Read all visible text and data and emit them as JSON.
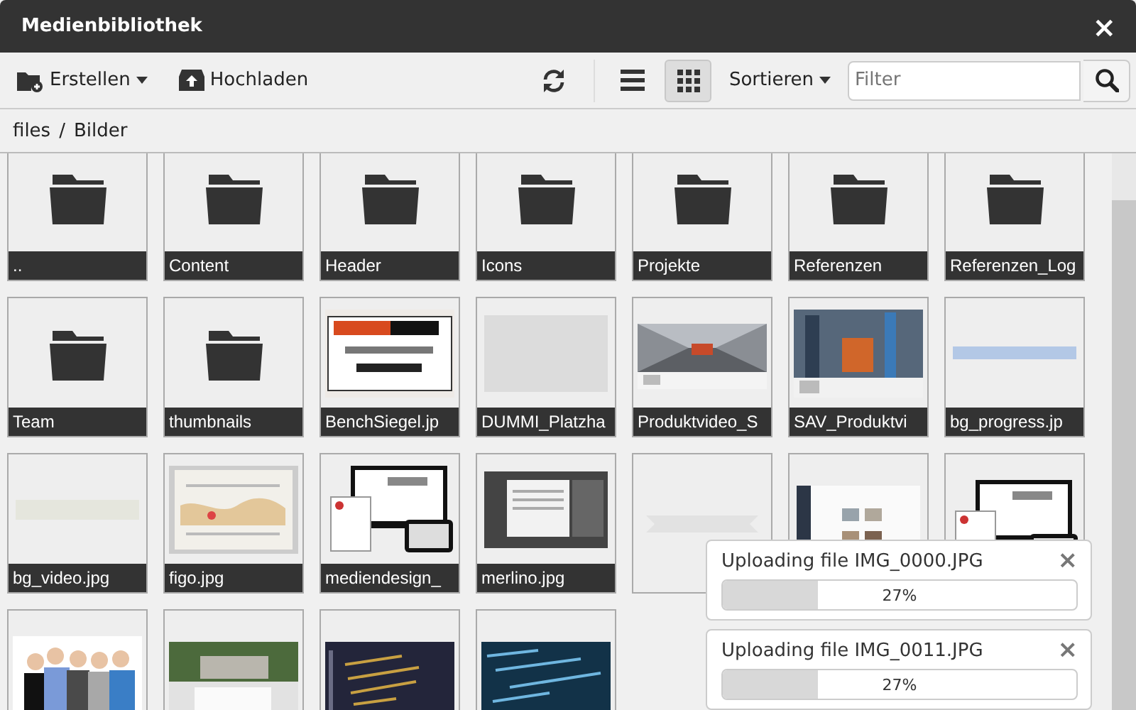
{
  "window": {
    "title": "Medienbibliothek",
    "close": "×"
  },
  "toolbar": {
    "create": "Erstellen",
    "upload": "Hochladen",
    "views": [
      {
        "kind": "list",
        "selected": false
      },
      {
        "kind": "grid",
        "selected": true
      }
    ],
    "sort": "Sortieren",
    "filter": {
      "placeholder": "Filter"
    }
  },
  "breadcrumb": {
    "items": [
      "files",
      "Bilder"
    ],
    "separator": "/"
  },
  "tiles": [
    {
      "kind": "folder",
      "label": ".."
    },
    {
      "kind": "folder",
      "label": "Content"
    },
    {
      "kind": "folder",
      "label": "Header"
    },
    {
      "kind": "folder",
      "label": "Icons"
    },
    {
      "kind": "folder",
      "label": "Projekte"
    },
    {
      "kind": "folder",
      "label": "Referenzen"
    },
    {
      "kind": "folder",
      "label": "Referenzen_Log"
    },
    {
      "kind": "folder",
      "label": "Team"
    },
    {
      "kind": "folder",
      "label": "thumbnails"
    },
    {
      "kind": "picture",
      "label": "BenchSiegel.jp"
    },
    {
      "kind": "picture",
      "label": "DUMMI_Platzha"
    },
    {
      "kind": "picture",
      "label": "Produktvideo_S"
    },
    {
      "kind": "picture",
      "label": "SAV_Produktvi"
    },
    {
      "kind": "picture",
      "label": "bg_progress.jp"
    },
    {
      "kind": "picture",
      "label": "bg_video.jpg"
    },
    {
      "kind": "picture",
      "label": "figo.jpg"
    },
    {
      "kind": "picture",
      "label": "mediendesign_"
    },
    {
      "kind": "picture",
      "label": "merlino.jpg"
    },
    {
      "kind": "picture"
    },
    {
      "kind": "picture"
    },
    {
      "kind": "picture"
    },
    {
      "kind": "picture"
    },
    {
      "kind": "picture"
    },
    {
      "kind": "picture"
    },
    {
      "kind": "picture"
    }
  ],
  "uploads": [
    {
      "title": "Uploading file IMG_0000.JPG",
      "level": 0.27,
      "reading": "27%"
    },
    {
      "title": "Uploading file IMG_0011.JPG",
      "level": 0.27,
      "reading": "27%"
    }
  ]
}
